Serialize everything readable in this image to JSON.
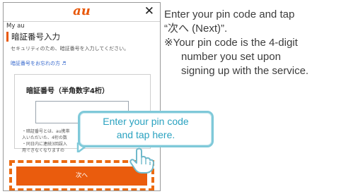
{
  "phone": {
    "logo": "au",
    "close_symbol": "✕",
    "breadcrumb": "My au",
    "heading": "暗証番号入力",
    "subtext": "セキュリティのため、暗証番号を入力してください。",
    "forgot_link": "暗証番号をお忘れの方 ♬",
    "field_label": "暗証番号（半角数字4桁）",
    "pin_value": "",
    "notes": [
      "・暗証番号とは、au携帯",
      "  入いただいた、4桁の数",
      "・同日内に連続3回誤入",
      "  用できなくなりますの"
    ],
    "next_button": "次へ"
  },
  "callout": {
    "line1": "Enter your pin code",
    "line2": "and tap here."
  },
  "instructions": {
    "line1": "Enter your pin code and tap",
    "line2": "“次へ (Next)”.",
    "note_mark": "※",
    "note_line1": "Your pin code is the 4-digit",
    "note_line2": "number you set upon",
    "note_line3": "signing up with the service."
  },
  "colors": {
    "brand_orange": "#ea5c0d",
    "callout_border": "#7fc9d9",
    "callout_text": "#2aa2c0"
  },
  "icons": {
    "close": "close-icon",
    "pointer": "hand-pointer-icon"
  }
}
